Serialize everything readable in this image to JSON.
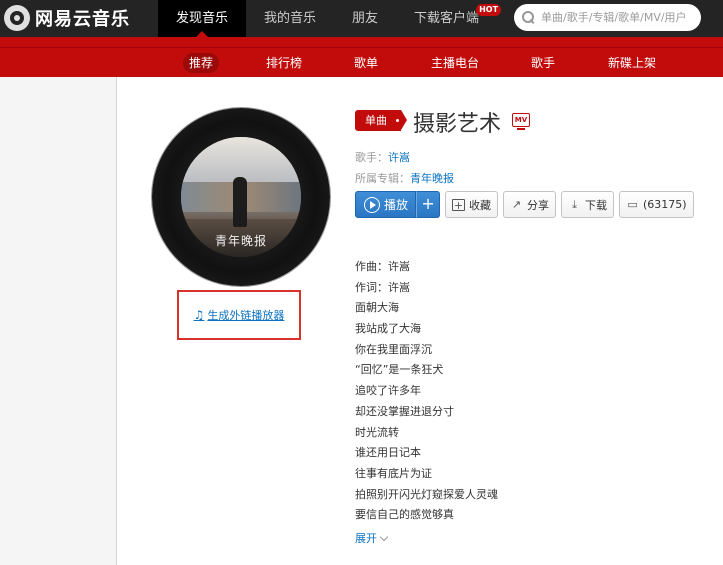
{
  "app": {
    "name": "网易云音乐"
  },
  "topnav": {
    "items": [
      {
        "label": "发现音乐",
        "active": true
      },
      {
        "label": "我的音乐"
      },
      {
        "label": "朋友"
      },
      {
        "label": "下载客户端",
        "badge": "HOT"
      }
    ]
  },
  "search": {
    "placeholder": "单曲/歌手/专辑/歌单/MV/用户",
    "value": ""
  },
  "subnav": {
    "items": [
      "推荐",
      "排行榜",
      "歌单",
      "主播电台",
      "歌手",
      "新碟上架"
    ],
    "active": "推荐"
  },
  "disc": {
    "cover_text": "青年晚报",
    "player_link": "生成外链播放器"
  },
  "song": {
    "type_badge": "单曲",
    "title": "摄影艺术",
    "mv_icon": "MV",
    "singer_label": "歌手：",
    "singer": "许嵩",
    "album_label": "所属专辑：",
    "album": "青年晚报"
  },
  "actions": {
    "play": "播放",
    "add": "+",
    "collect": "收藏",
    "share": "分享",
    "download": "下载",
    "comments": "(63175)"
  },
  "lyrics": [
    "作曲：许嵩",
    "作词：许嵩",
    "面朝大海",
    "我站成了大海",
    "你在我里面浮沉",
    "“回忆”是一条狂犬",
    "追咬了许多年",
    "却还没掌握进退分寸",
    "时光流转",
    "谁还用日记本",
    "往事有底片为证",
    "拍照别开闪光灯窥探爱人灵魂",
    "要信自己的感觉够真"
  ],
  "expand_label": "展开",
  "colors": {
    "brand_red": "#c20c0c",
    "link_blue": "#0c73c2",
    "topbar": "#242424"
  }
}
